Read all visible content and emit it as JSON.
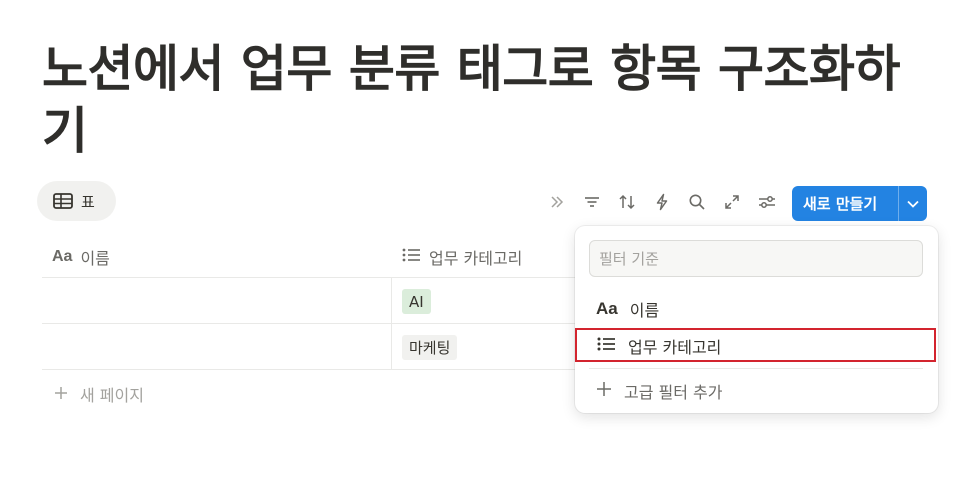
{
  "page": {
    "title": "노션에서 업무 분류 태그로 항목 구조화하기"
  },
  "view": {
    "tab_label": "표"
  },
  "toolbar": {
    "icons": [
      "chevrons-right-icon",
      "filter-icon",
      "sort-icon",
      "lightning-icon",
      "search-icon",
      "expand-icon",
      "settings-sliders-icon"
    ],
    "new_button_label": "새로 만들기",
    "accent": "#2383e2"
  },
  "table": {
    "columns": [
      {
        "label": "이름",
        "icon": "text-type-icon"
      },
      {
        "label": "업무 카테고리",
        "icon": "list-icon"
      }
    ],
    "rows": [
      {
        "name": "",
        "category": "AI",
        "tag_color": "#dbeddb"
      },
      {
        "name": "",
        "category": "마케팅",
        "tag_color": "#f1f1ef"
      }
    ],
    "new_page_label": "새 페이지"
  },
  "filter_popup": {
    "search_placeholder": "필터 기준",
    "search_value": "",
    "items": [
      {
        "label": "이름",
        "icon": "text-type-icon"
      },
      {
        "label": "업무 카테고리",
        "icon": "list-icon"
      }
    ],
    "advanced_label": "고급 필터 추가",
    "highlight_color": "#d3242e"
  }
}
